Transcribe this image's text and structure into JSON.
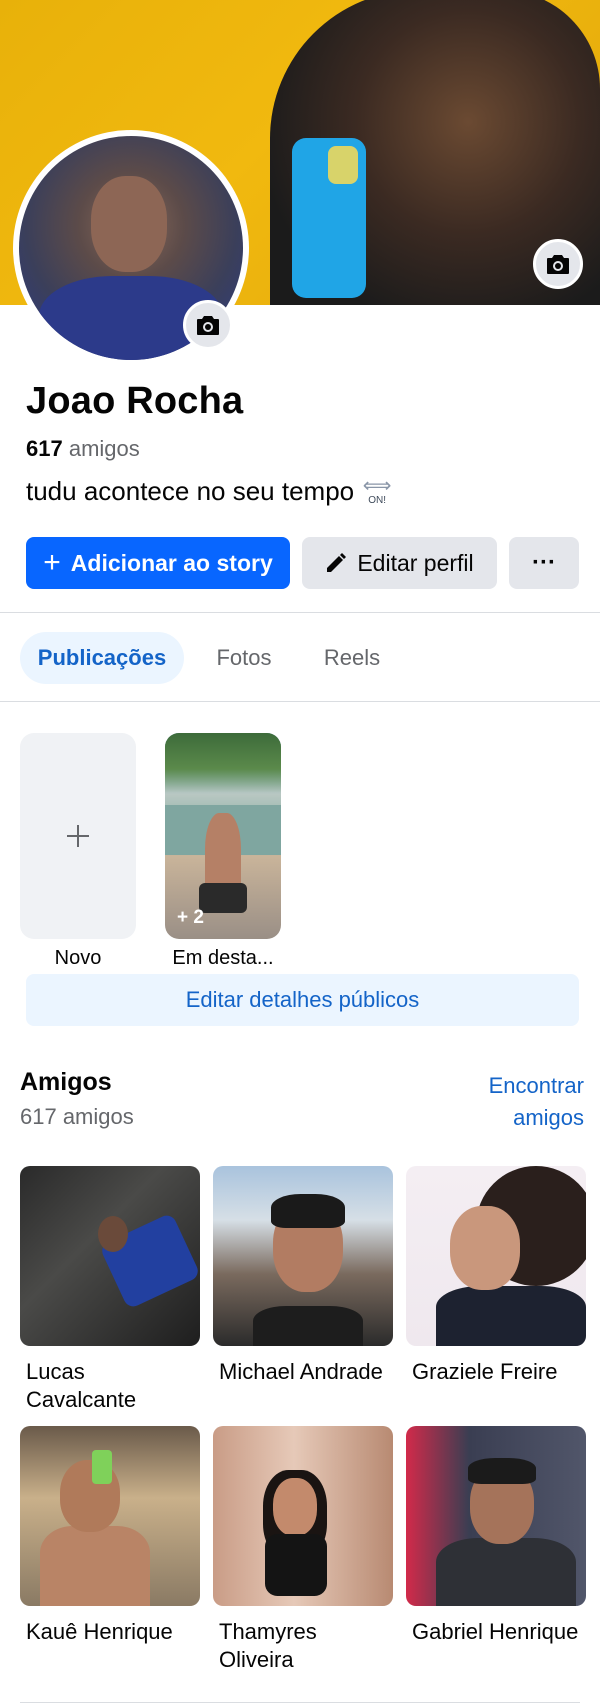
{
  "profile": {
    "name": "Joao Rocha",
    "friends_count": "617",
    "friends_word": "amigos",
    "bio": "tudu acontece no seu tempo",
    "bio_emoji_text": "ON!"
  },
  "actions": {
    "add_story": "Adicionar ao story",
    "edit_profile": "Editar perfil",
    "more": "···"
  },
  "tabs": [
    {
      "label": "Publicações",
      "active": true
    },
    {
      "label": "Fotos",
      "active": false
    },
    {
      "label": "Reels",
      "active": false
    }
  ],
  "highlights": {
    "new_label": "Novo",
    "featured_label": "Em desta...",
    "featured_count": "+ 2",
    "edit_details": "Editar detalhes públicos"
  },
  "friends_section": {
    "title": "Amigos",
    "subtitle": "617 amigos",
    "find_line1": "Encontrar",
    "find_line2": "amigos",
    "list": [
      {
        "name": "Lucas Cavalcante"
      },
      {
        "name": "Michael Andrade"
      },
      {
        "name": "Graziele Freire"
      },
      {
        "name": "Kauê Henrique"
      },
      {
        "name": "Thamyres Oliveira"
      },
      {
        "name": "Gabriel Henrique"
      }
    ]
  },
  "colors": {
    "primary": "#0866ff",
    "link": "#1464c8",
    "cover_yellow": "#f1b90f"
  },
  "icons": [
    "camera-icon",
    "plus-icon",
    "pencil-icon",
    "more-icon"
  ]
}
